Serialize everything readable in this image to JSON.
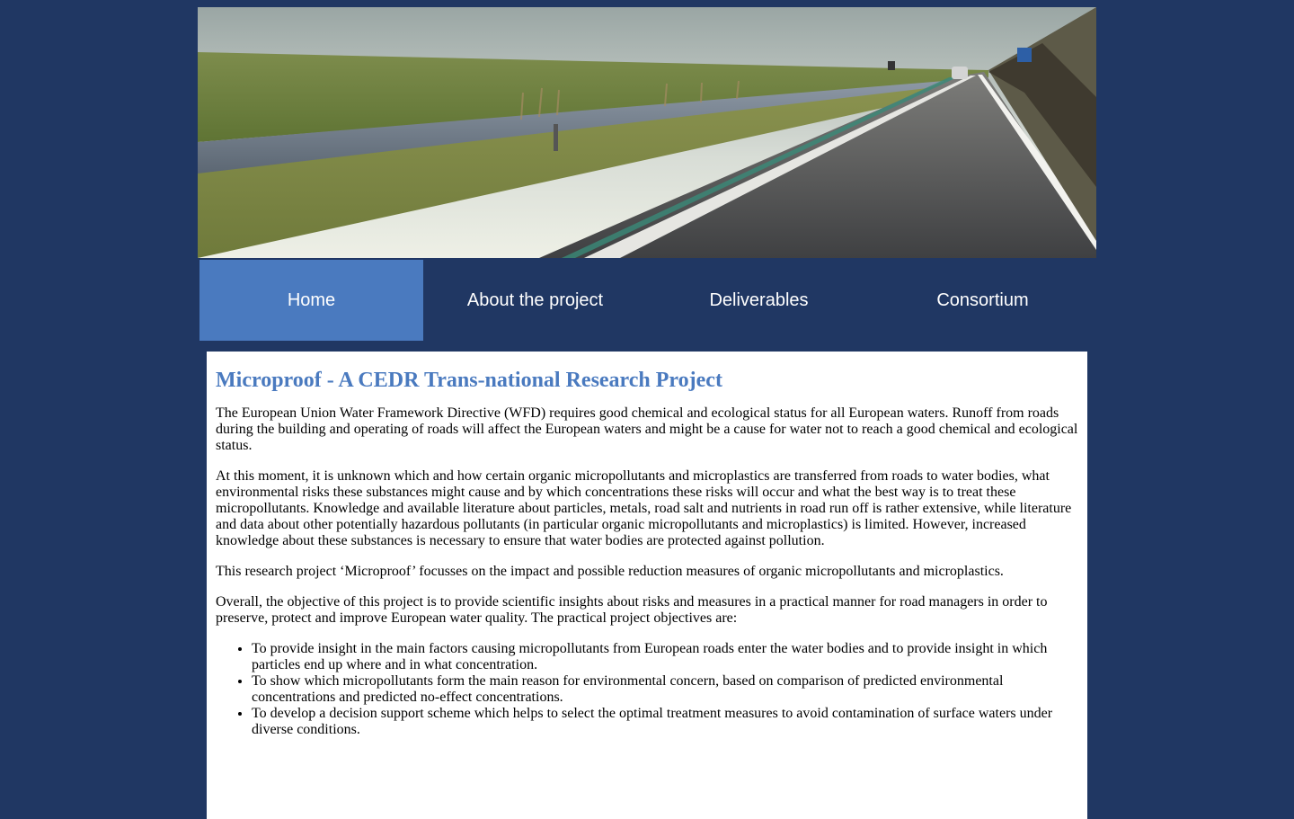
{
  "banner": {
    "alt": "Road alongside a canal and dike"
  },
  "nav": {
    "items": [
      {
        "label": "Home",
        "active": true
      },
      {
        "label": "About the project",
        "active": false
      },
      {
        "label": "Deliverables",
        "active": false
      },
      {
        "label": "Consortium",
        "active": false
      }
    ]
  },
  "content": {
    "title": "Microproof - A CEDR Trans-national Research Project",
    "paragraphs": [
      "The European Union Water Framework Directive (WFD) requires good chemical and ecological status for all European waters. Runoff from roads during the building and operating of roads will affect the European waters and might be a cause for water not to reach a good chemical and ecological status.",
      "At this moment, it is unknown which and how certain organic micropollutants and microplastics are transferred from roads to water bodies, what environmental risks these substances might cause and by which concentrations these risks will occur and what the best way is to treat these micropollutants. Knowledge and available literature about particles, metals, road salt and nutrients in road run off is rather extensive, while literature and data about other potentially hazardous pollutants (in particular organic micropollutants and microplastics) is limited. However, increased knowledge about these substances is necessary to ensure that water bodies are protected against pollution.",
      "This research project ‘Microproof’ focusses on the impact and possible reduction measures of organic micropollutants and microplastics.",
      "Overall, the objective of this project is to provide scientific insights about risks and measures in a practical manner for road managers in order to preserve, protect and improve European water quality. The practical project objectives are:"
    ],
    "objectives": [
      "To provide insight in the main factors causing micropollutants from European roads enter the water bodies and to provide insight in which particles end up where and in what concentration.",
      "To show which micropollutants form the main reason for environmental concern, based on comparison of predicted environmental concentrations and predicted no-effect concentrations.",
      "To develop a decision support scheme which helps to select the optimal treatment measures to avoid contamination of surface waters under diverse conditions."
    ]
  },
  "colors": {
    "page_background": "#203763",
    "nav_active": "#4a7abf",
    "title": "#4a7abf",
    "content_background": "#ffffff"
  }
}
